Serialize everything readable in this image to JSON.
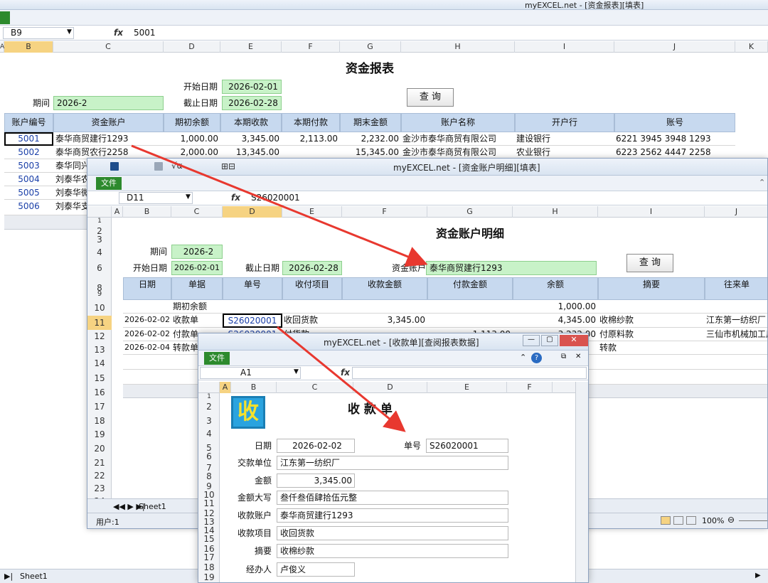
{
  "back": {
    "title": "myEXCEL.net - [资金报表][填表]",
    "namebox": "B9",
    "formula": "5001",
    "cols": [
      "A",
      "B",
      "C",
      "D",
      "E",
      "F",
      "G",
      "H",
      "I",
      "J",
      "K"
    ],
    "report_title": "资金报表",
    "start_label": "开始日期",
    "start_value": "2026-02-01",
    "end_label": "截止日期",
    "end_value": "2026-02-28",
    "period_label": "期间",
    "period_value": "2026-2",
    "query": "查 询",
    "headers": [
      "账户编号",
      "资金账户",
      "期初余额",
      "本期收款",
      "本期付款",
      "期末金额",
      "账户名称",
      "开户行",
      "账号"
    ],
    "rows": [
      [
        "5001",
        "泰华商贸建行1293",
        "1,000.00",
        "3,345.00",
        "2,113.00",
        "2,232.00",
        "金沙市泰华商贸有限公司",
        "建设银行",
        "6221 3945 3948 1293"
      ],
      [
        "5002",
        "泰华商贸农行2258",
        "2,000.00",
        "13,345.00",
        "",
        "15,345.00",
        "金沙市泰华商贸有限公司",
        "农业银行",
        "6223 2562 4447 2258"
      ],
      [
        "5003",
        "泰华同兴",
        "",
        "",
        "",
        "",
        "",
        "",
        ""
      ],
      [
        "5004",
        "刘泰华农",
        "",
        "",
        "",
        "",
        "",
        "",
        ""
      ],
      [
        "5005",
        "刘泰华微",
        "",
        "",
        "",
        "",
        "",
        "",
        ""
      ],
      [
        "5006",
        "刘泰华支",
        "",
        "",
        "",
        "",
        "",
        "",
        ""
      ]
    ],
    "sheet": "Sheet1"
  },
  "mid": {
    "title": "myEXCEL.net - [资金账户明细][填表]",
    "file": "文件",
    "namebox": "D11",
    "formula": "S26020001",
    "cols": [
      "A",
      "B",
      "C",
      "D",
      "E",
      "F",
      "G",
      "H",
      "I",
      "J"
    ],
    "rownums": [
      "1",
      "2",
      "3",
      "4",
      "6",
      "8",
      "9",
      "10",
      "11",
      "12",
      "13",
      "14",
      "15",
      "16",
      "17",
      "18",
      "19",
      "20",
      "21",
      "22",
      "23",
      "24"
    ],
    "report_title": "资金账户明细",
    "period_label": "期间",
    "period_value": "2026-2",
    "start_label": "开始日期",
    "start_value": "2026-02-01",
    "end_label": "截止日期",
    "end_value": "2026-02-28",
    "account_label": "资金账户",
    "account_value": "泰华商贸建行1293",
    "query": "查 询",
    "headers": [
      "日期",
      "单据",
      "单号",
      "收付项目",
      "收款金额",
      "付款金额",
      "余额",
      "摘要",
      "往来单"
    ],
    "opening_label": "期初余额",
    "opening_value": "1,000.00",
    "rows": [
      [
        "2026-02-02",
        "收款单",
        "S26020001",
        "收回货款",
        "3,345.00",
        "",
        "4,345.00",
        "收棉纱款",
        "江东第一纺织厂"
      ],
      [
        "2026-02-02",
        "付款单",
        "S26020001",
        "付货款",
        "",
        "1,113.00",
        "3,232.00",
        "付原料款",
        "三仙市机械加工厂"
      ],
      [
        "2026-02-04",
        "转款单",
        "",
        "",
        "",
        "",
        "",
        "转款",
        ""
      ]
    ],
    "status": "用户:1",
    "sheet": "Sheet1",
    "zoom": "100%"
  },
  "front": {
    "title": "myEXCEL.net - [收款单][查阅报表数据]",
    "file": "文件",
    "namebox": "A1",
    "cols": [
      "A",
      "B",
      "C",
      "D",
      "E",
      "F"
    ],
    "rownums": [
      "1",
      "2",
      "3",
      "4",
      "5",
      "6",
      "7",
      "8",
      "9",
      "10",
      "11",
      "12",
      "13",
      "14",
      "15",
      "16",
      "17",
      "18",
      "19"
    ],
    "logo": "收",
    "report_title": "收 款 单",
    "date_label": "日期",
    "date_value": "2026-02-02",
    "no_label": "单号",
    "no_value": "S26020001",
    "payer_label": "交款单位",
    "payer_value": "江东第一纺织厂",
    "amount_label": "金额",
    "amount_value": "3,345.00",
    "capital_label": "金额大写",
    "capital_value": "叁仟叁佰肆拾伍元整",
    "account_label": "收款账户",
    "account_value": "泰华商贸建行1293",
    "item_label": "收款项目",
    "item_value": "收回货款",
    "memo_label": "摘要",
    "memo_value": "收棉纱款",
    "handler_label": "经办人",
    "handler_value": "卢俊义"
  },
  "colors": {
    "green": "#c8f2c8",
    "header_blue": "#c7d9ef",
    "arrow": "#e8382f",
    "file_green": "#2d8a2d"
  }
}
